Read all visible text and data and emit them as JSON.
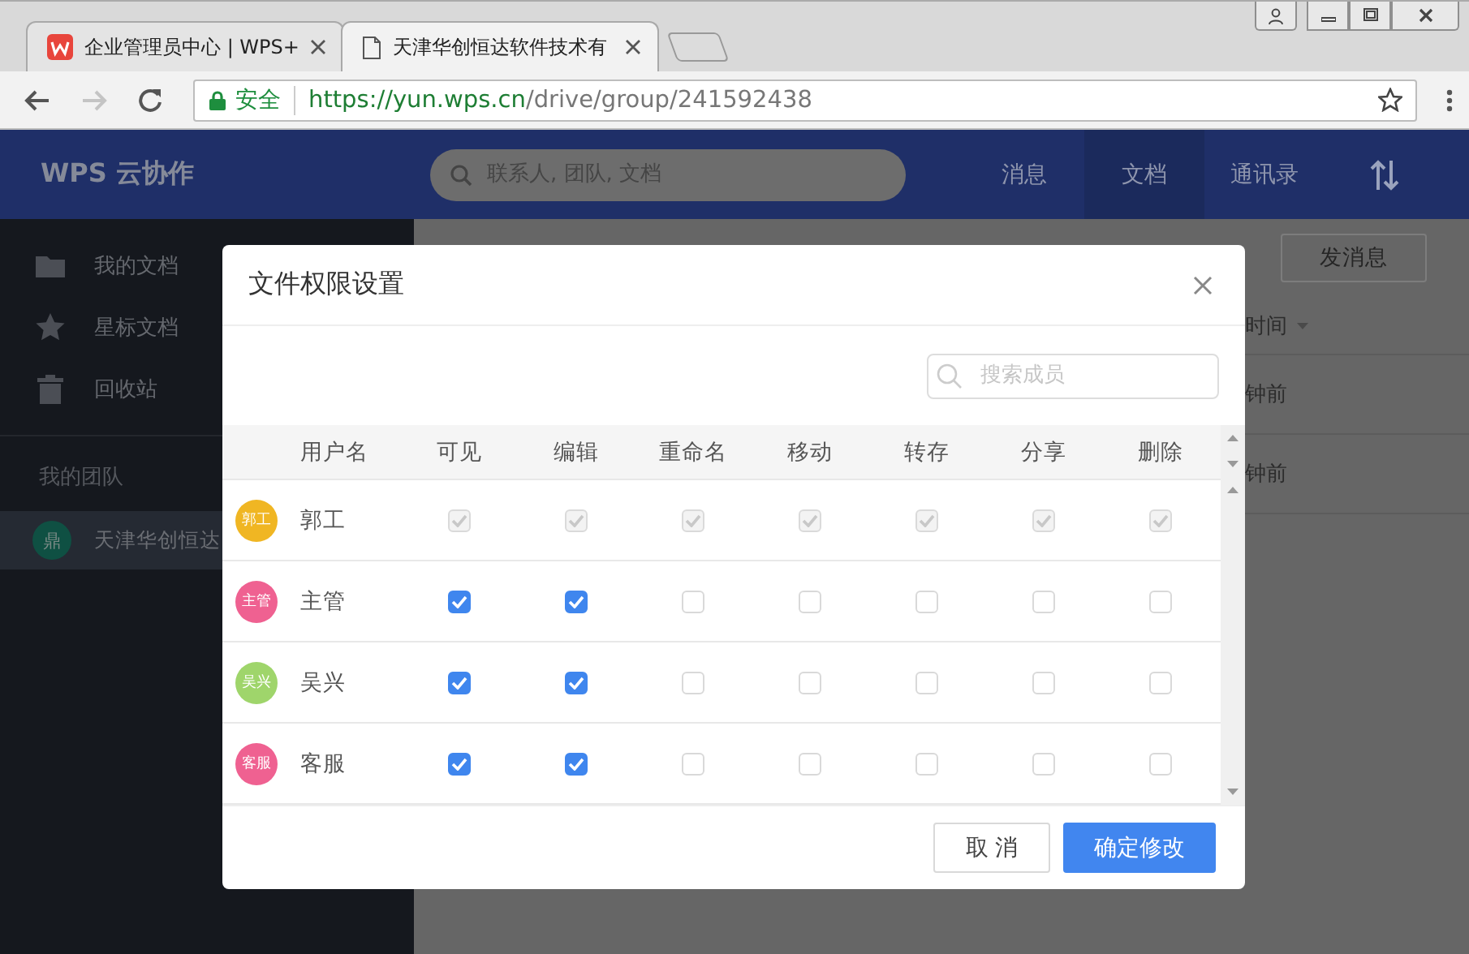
{
  "browser": {
    "tabs": [
      {
        "title": "企业管理员中心 | WPS+",
        "selected": false,
        "kind": "wps"
      },
      {
        "title": "天津华创恒达软件技术有",
        "selected": true,
        "kind": "page"
      }
    ],
    "security": "安全",
    "url_host": "https://yun.wps.cn",
    "url_path": "/drive/group/241592438",
    "forward_disabled": true
  },
  "app": {
    "logo": "WPS 云协作",
    "search": {
      "placeholder": "联系人, 团队, 文档"
    },
    "nav": [
      {
        "label": "消息",
        "selected": false
      },
      {
        "label": "文档",
        "selected": true
      },
      {
        "label": "通讯录",
        "selected": false
      }
    ]
  },
  "sidebar": {
    "items": [
      {
        "label": "我的文档",
        "kind": "folder"
      },
      {
        "label": "星标文档",
        "kind": "star"
      },
      {
        "label": "回收站",
        "kind": "trash"
      }
    ],
    "team_heading": "我的团队",
    "teams": [
      {
        "avatar": "鼎",
        "name": "天津华创恒达",
        "selected": true
      }
    ]
  },
  "main": {
    "button": "发消息",
    "column": "时间",
    "rows": [
      "钟前",
      "钟前"
    ]
  },
  "dialog": {
    "title": "文件权限设置",
    "search": {
      "placeholder": "搜索成员"
    },
    "columns": [
      "用户名",
      "可见",
      "编辑",
      "重命名",
      "移动",
      "转存",
      "分享",
      "删除"
    ],
    "rows": [
      {
        "avatar": "郭工",
        "name": "郭工",
        "color": "#f0b623",
        "perms": [
          {
            "checked": true,
            "disabled": true
          },
          {
            "checked": true,
            "disabled": true
          },
          {
            "checked": true,
            "disabled": true
          },
          {
            "checked": true,
            "disabled": true
          },
          {
            "checked": true,
            "disabled": true
          },
          {
            "checked": true,
            "disabled": true
          },
          {
            "checked": true,
            "disabled": true
          }
        ]
      },
      {
        "avatar": "主管",
        "name": "主管",
        "color": "#ef6191",
        "perms": [
          {
            "checked": true,
            "disabled": false
          },
          {
            "checked": true,
            "disabled": false
          },
          {
            "checked": false,
            "disabled": false
          },
          {
            "checked": false,
            "disabled": false
          },
          {
            "checked": false,
            "disabled": false
          },
          {
            "checked": false,
            "disabled": false
          },
          {
            "checked": false,
            "disabled": false
          }
        ]
      },
      {
        "avatar": "吴兴",
        "name": "吴兴",
        "color": "#9fd56b",
        "perms": [
          {
            "checked": true,
            "disabled": false
          },
          {
            "checked": true,
            "disabled": false
          },
          {
            "checked": false,
            "disabled": false
          },
          {
            "checked": false,
            "disabled": false
          },
          {
            "checked": false,
            "disabled": false
          },
          {
            "checked": false,
            "disabled": false
          },
          {
            "checked": false,
            "disabled": false
          }
        ]
      },
      {
        "avatar": "客服",
        "name": "客服",
        "color": "#ef6191",
        "perms": [
          {
            "checked": true,
            "disabled": false
          },
          {
            "checked": true,
            "disabled": false
          },
          {
            "checked": false,
            "disabled": false
          },
          {
            "checked": false,
            "disabled": false
          },
          {
            "checked": false,
            "disabled": false
          },
          {
            "checked": false,
            "disabled": false
          },
          {
            "checked": false,
            "disabled": false
          }
        ]
      }
    ],
    "cancel": "取 消",
    "confirm": "确定修改"
  }
}
